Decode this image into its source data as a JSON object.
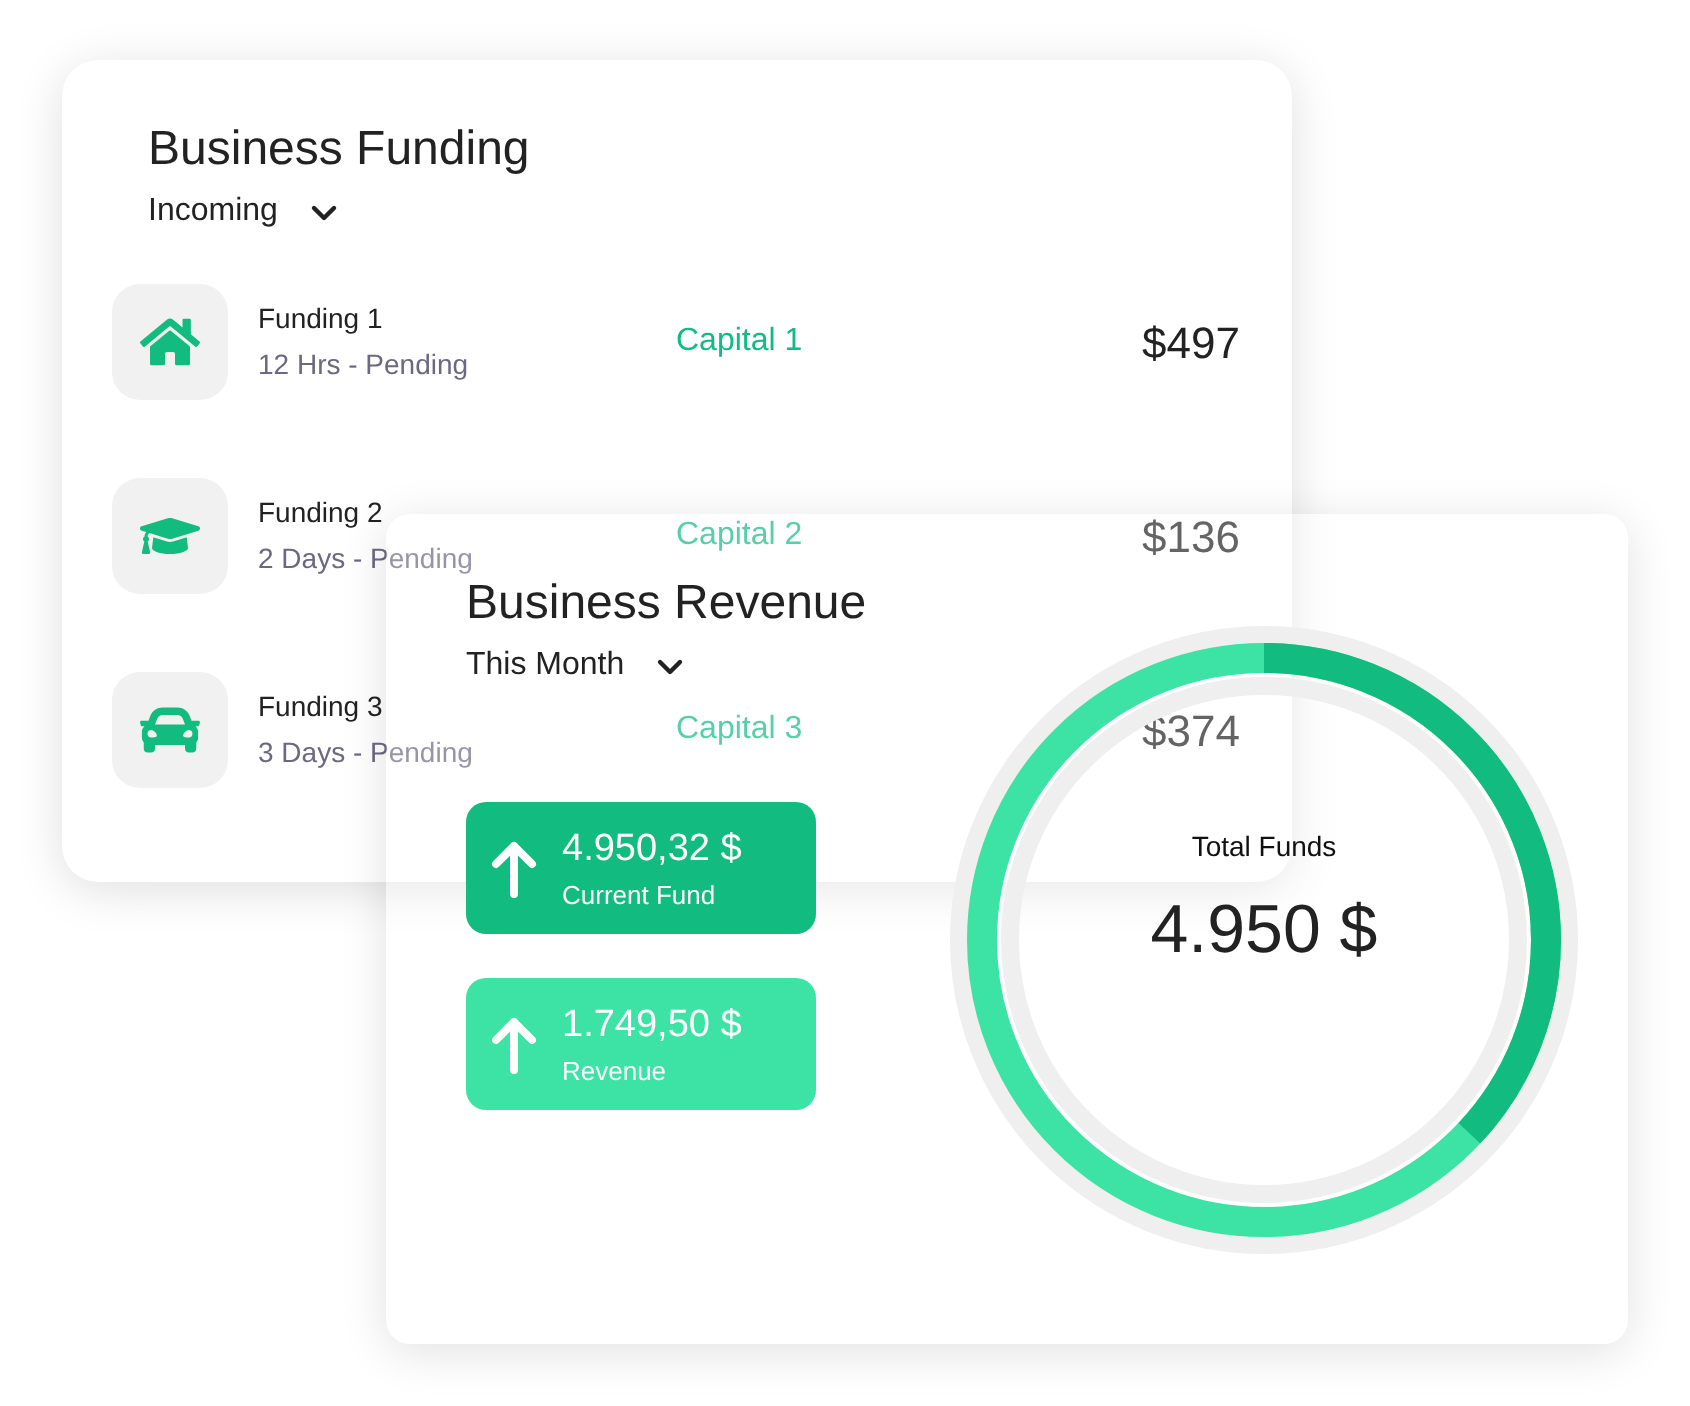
{
  "funding_card": {
    "title": "Business Funding",
    "filter": "Incoming",
    "items": [
      {
        "kind": "home",
        "name": "Funding 1",
        "status": "12 Hrs - Pending",
        "source": "Capital 1",
        "amount": "$497"
      },
      {
        "kind": "education",
        "name": "Funding 2",
        "status": "2 Days - Pending",
        "source": "Capital 2",
        "amount": "$136"
      },
      {
        "kind": "car",
        "name": "Funding 3",
        "status": "3 Days - Pending",
        "source": "Capital 3",
        "amount": "$374"
      }
    ]
  },
  "revenue_card": {
    "title": "Business Revenue",
    "filter": "This Month",
    "stats": [
      {
        "kind": "dark",
        "value": "4.950,32 $",
        "label": "Current Fund"
      },
      {
        "kind": "light",
        "value": "1.749,50 $",
        "label": "Revenue"
      }
    ],
    "gauge": {
      "label": "Total Funds",
      "value": "4.950 $",
      "level": 0.37
    }
  }
}
